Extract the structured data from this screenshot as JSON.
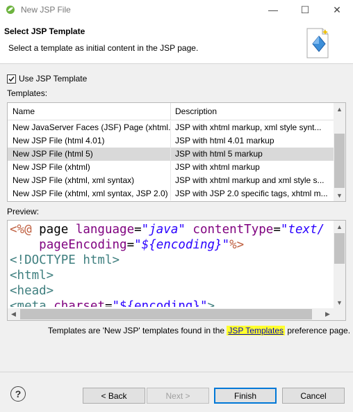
{
  "window": {
    "title": "New JSP File",
    "minimize_glyph": "—",
    "maximize_glyph": "☐",
    "close_glyph": "✕"
  },
  "banner": {
    "heading": "Select JSP Template",
    "description": "Select a template as initial content in the JSP page."
  },
  "use_template": {
    "label": "Use JSP Template",
    "checked": true
  },
  "templates_label": "Templates:",
  "table": {
    "columns": [
      "Name",
      "Description"
    ],
    "rows": [
      {
        "name": "New JavaServer Faces (JSF) Page (xhtml...",
        "description": "JSP with xhtml markup, xml style synt..."
      },
      {
        "name": "New JSP File (html 4.01)",
        "description": "JSP with html 4.01 markup"
      },
      {
        "name": "New JSP File (html 5)",
        "description": "JSP with html 5 markup",
        "selected": true
      },
      {
        "name": "New JSP File (xhtml)",
        "description": "JSP with xhtml markup"
      },
      {
        "name": "New JSP File (xhtml, xml syntax)",
        "description": "JSP with xhtml markup and xml style s..."
      },
      {
        "name": "New JSP File (xhtml, xml syntax, JSP 2.0)",
        "description": "JSP with JSP 2.0 specific tags, xhtml m..."
      }
    ]
  },
  "preview_label": "Preview:",
  "preview": {
    "line1": {
      "open": "<%@",
      "directive": " page ",
      "attr1": "language",
      "eq1": "=",
      "val1": "\"java\"",
      "attr2": " contentType",
      "eq2": "=",
      "val2": "\"text/"
    },
    "line2": {
      "indent": "    ",
      "attr": "pageEncoding",
      "eq": "=",
      "q_open": "\"",
      "var": "${encoding}",
      "q_close": "\"",
      "close": "%>"
    },
    "line3": "<!DOCTYPE html>",
    "line4": "<html>",
    "line5": "<head>",
    "line6": {
      "tag": "<meta",
      "attr": " charset",
      "eq": "=",
      "val": "\"${encoding}\"",
      "close": ">"
    }
  },
  "info": {
    "prefix": "Templates are 'New JSP' templates found in the ",
    "link": "JSP Templates",
    "suffix": " preference page."
  },
  "buttons": {
    "help": "?",
    "back": "< Back",
    "next": "Next >",
    "finish": "Finish",
    "cancel": "Cancel"
  }
}
